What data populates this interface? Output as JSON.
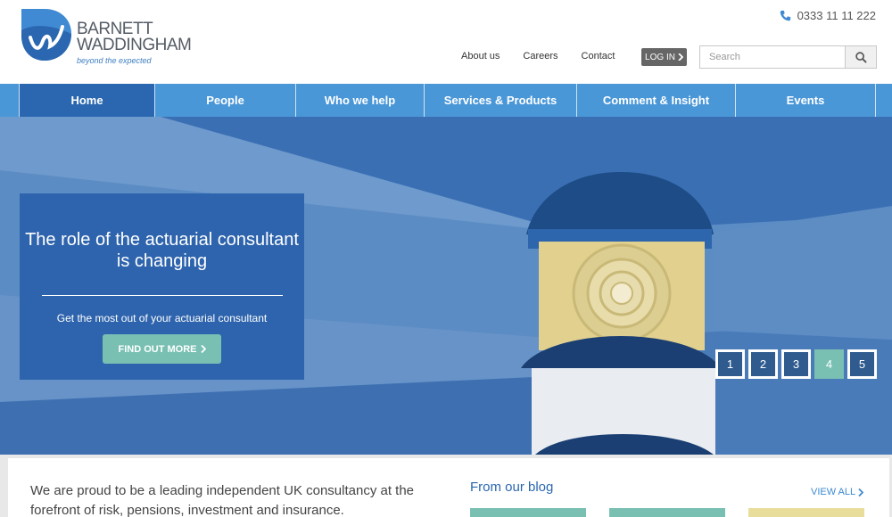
{
  "brand": {
    "name_line1": "BARNETT",
    "name_line2": "WADDINGHAM",
    "tagline": "beyond the expected",
    "primary_color": "#2a67b0",
    "nav_color": "#4a97d8",
    "accent_color": "#79c0b3"
  },
  "header": {
    "phone": "0333 11 11 222",
    "phone_icon": "phone-icon",
    "links": [
      "About us",
      "Careers",
      "Contact"
    ],
    "login_label": "LOG IN",
    "search_placeholder": "Search",
    "search_icon": "magnifier-icon"
  },
  "nav": {
    "items": [
      {
        "label": "Home",
        "active": true
      },
      {
        "label": "People",
        "active": false
      },
      {
        "label": "Who we help",
        "active": false
      },
      {
        "label": "Services & Products",
        "active": false
      },
      {
        "label": "Comment & Insight",
        "active": false
      },
      {
        "label": "Events",
        "active": false
      }
    ]
  },
  "hero": {
    "title": "The role of the actuarial consultant is changing",
    "subtitle": "Get the most out of your actuarial consultant",
    "cta_label": "FIND OUT MORE",
    "slides": [
      "1",
      "2",
      "3",
      "4",
      "5"
    ],
    "active_slide": "4"
  },
  "content": {
    "intro": "We are proud to be a leading independent UK consultancy at the forefront of risk, pensions, investment and insurance.",
    "blog_title": "From our blog",
    "view_all_label": "VIEW ALL"
  }
}
